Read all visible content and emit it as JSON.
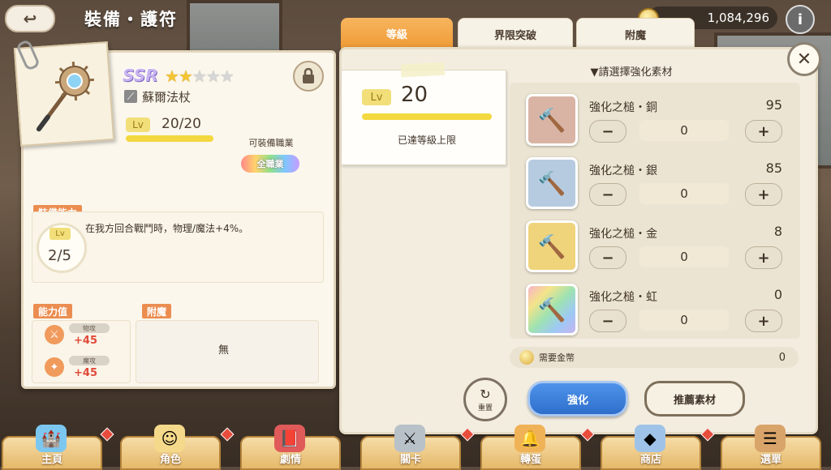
{
  "header": {
    "title": "裝備・護符",
    "gold": "1,084,296"
  },
  "item": {
    "rarity": "SSR",
    "stars_filled": 2,
    "stars_total": 5,
    "name": "蘇爾法杖",
    "level_badge": "Lv",
    "level_value": "20/20",
    "job_label": "可裝備職業",
    "job_value": "全職業"
  },
  "ability": {
    "section_label": "裝備能力",
    "level_badge": "Lv",
    "level_value": "2/5",
    "description": "在我方回合戰鬥時，物理/魔法+4%。"
  },
  "stats": {
    "section_label": "能力值",
    "items": [
      {
        "name": "物攻",
        "value": "+45",
        "icon": "sword-icon"
      },
      {
        "name": "魔攻",
        "value": "+45",
        "icon": "staff-icon"
      }
    ]
  },
  "enchant": {
    "section_label": "附魔",
    "value": "無"
  },
  "tabs": [
    {
      "label": "等級",
      "active": true
    },
    {
      "label": "界限突破",
      "active": false
    },
    {
      "label": "附魔",
      "active": false
    }
  ],
  "level_card": {
    "badge": "Lv",
    "value": "20",
    "note": "已達等級上限"
  },
  "materials": {
    "heading": "▼請選擇強化素材",
    "items": [
      {
        "name": "強化之槌・銅",
        "count": "95",
        "qty": "0",
        "color": "#d9b4a4"
      },
      {
        "name": "強化之槌・銀",
        "count": "85",
        "qty": "0",
        "color": "#b7cbe0"
      },
      {
        "name": "強化之槌・金",
        "count": "8",
        "qty": "0",
        "color": "#f0d47b"
      },
      {
        "name": "強化之槌・虹",
        "count": "0",
        "qty": "0",
        "color": "#c6b5ef"
      }
    ],
    "minus_label": "−",
    "plus_label": "+"
  },
  "cost": {
    "label": "需要金幣",
    "value": "0"
  },
  "actions": {
    "reset": "重置",
    "enhance": "強化",
    "recommend": "推薦素材"
  },
  "bottom_nav": [
    "主頁",
    "角色",
    "劇情",
    "關卡",
    "轉蛋",
    "商店",
    "選單"
  ],
  "colors": {
    "accent_orange": "#ef9a35",
    "enhance_blue": "#2e6fcc",
    "stat_red": "#e2493a"
  }
}
